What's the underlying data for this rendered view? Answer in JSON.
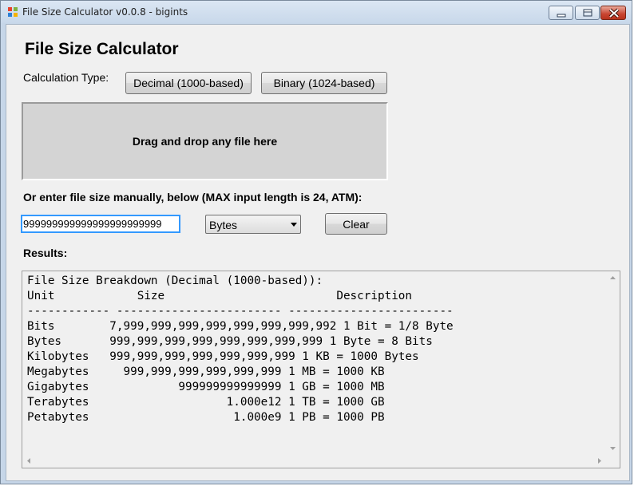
{
  "window": {
    "title": "File Size Calculator v0.0.8 - bigints",
    "icon": "app-icon"
  },
  "header": {
    "title": "File Size Calculator"
  },
  "calc_type": {
    "label": "Calculation Type:",
    "decimal_button": "Decimal (1000-based)",
    "binary_button": "Binary (1024-based)"
  },
  "dropzone": {
    "text": "Drag and drop any file here"
  },
  "manual": {
    "label": "Or enter file size manually, below (MAX input length is 24, ATM):",
    "input_value": "999999999999999999999999",
    "unit_selected": "Bytes",
    "clear_button": "Clear"
  },
  "results": {
    "label": "Results:",
    "lines": [
      "File Size Breakdown (Decimal (1000-based)):",
      "Unit            Size                         Description",
      "------------ ------------------------ ------------------------",
      "Bits        7,999,999,999,999,999,999,999,992 1 Bit = 1/8 Byte",
      "Bytes       999,999,999,999,999,999,999,999 1 Byte = 8 Bits",
      "Kilobytes   999,999,999,999,999,999,999 1 KB = 1000 Bytes",
      "Megabytes     999,999,999,999,999,999 1 MB = 1000 KB",
      "Gigabytes             999999999999999 1 GB = 1000 MB",
      "Terabytes                    1.000e12 1 TB = 1000 GB",
      "Petabytes                     1.000e9 1 PB = 1000 PB"
    ]
  },
  "colors": {
    "titlebar": "#c8d8ea",
    "client": "#f0f0f0",
    "dropzone": "#d4d4d4",
    "close_button": "#c84531",
    "focus": "#3399ff"
  }
}
